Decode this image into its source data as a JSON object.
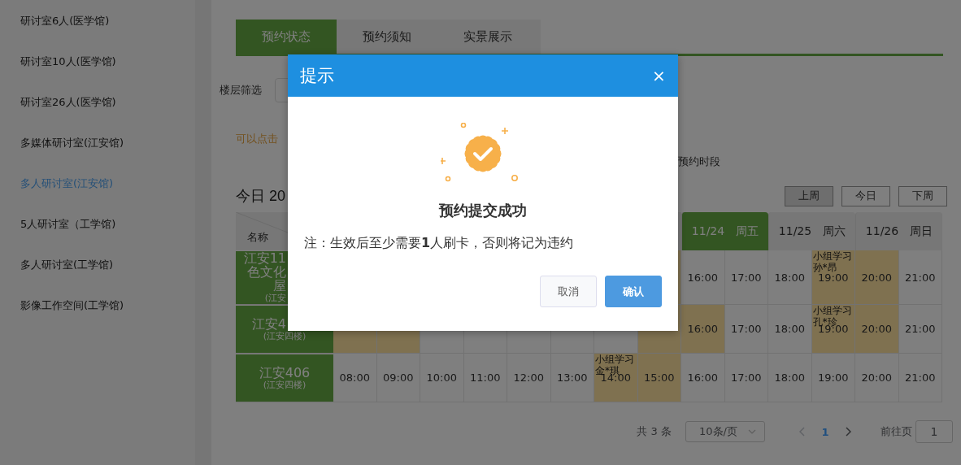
{
  "sidebar": {
    "items": [
      {
        "label": "研讨室6人(医学馆)",
        "selected": false
      },
      {
        "label": "研讨室10人(医学馆)",
        "selected": false
      },
      {
        "label": "研讨室26人(医学馆)",
        "selected": false
      },
      {
        "label": "多媒体研讨室(江安馆)",
        "selected": false
      },
      {
        "label": "多人研讨室(江安馆)",
        "selected": true
      },
      {
        "label": "5人研讨室（工学馆)",
        "selected": false
      },
      {
        "label": "多人研讨室(工学馆)",
        "selected": false
      },
      {
        "label": "影像工作空间(工学馆)",
        "selected": false
      }
    ]
  },
  "tabs": [
    {
      "label": "预约状态",
      "selected": true
    },
    {
      "label": "预约须知",
      "selected": false
    },
    {
      "label": "实景展示",
      "selected": false
    }
  ],
  "filter": {
    "label": "楼层筛选"
  },
  "hint": "可以点击",
  "legend_tail": "预约时段",
  "today_title": "今日 20",
  "week_buttons": [
    {
      "label": "上周",
      "selected": true
    },
    {
      "label": "今日",
      "selected": false
    },
    {
      "label": "下周",
      "selected": false
    }
  ],
  "table": {
    "name_header": "名称",
    "days": [
      {
        "date": "11/24",
        "weekday": "周五",
        "selected": true
      },
      {
        "date": "11/25",
        "weekday": "周六",
        "selected": false
      },
      {
        "date": "11/26",
        "weekday": "周日",
        "selected": false
      }
    ],
    "rows": [
      {
        "names": [
          {
            "text": "江安11",
            "covered": true
          },
          {
            "text": "色文化",
            "covered": true
          },
          {
            "text": "屋",
            "covered": true
          },
          {
            "text": "(江安",
            "covered": true,
            "small": true
          }
        ],
        "cells": [
          "",
          "",
          "",
          "",
          "",
          "",
          "",
          {
            "booked": true
          },
          {
            "time": "16:00",
            "booked": false
          },
          {
            "time": "17:00",
            "booked": false
          },
          {
            "time": "18:00",
            "booked": false
          },
          {
            "time": "19:00",
            "booked": true,
            "note": [
              "小组学习",
              "孙*昂"
            ]
          },
          {
            "time": "20:00",
            "booked": true
          },
          {
            "time": "21:00",
            "booked": false
          }
        ]
      },
      {
        "names": [
          {
            "text": "江安4",
            "covered": true
          },
          {
            "text": "(江安四楼)",
            "covered": false,
            "small": true
          }
        ],
        "cells": [
          {
            "booked": true
          },
          {
            "booked": true
          },
          {
            "booked": false
          },
          {
            "booked": false
          },
          {
            "booked": false
          },
          {
            "booked": false
          },
          {
            "booked": false
          },
          {
            "booked": true
          },
          {
            "time": "16:00",
            "booked": true
          },
          {
            "time": "17:00",
            "booked": false
          },
          {
            "time": "18:00",
            "booked": false
          },
          {
            "time": "19:00",
            "booked": true,
            "note": [
              "小组学习",
              "孔*珍"
            ]
          },
          {
            "time": "20:00",
            "booked": true
          },
          {
            "time": "21:00",
            "booked": false
          }
        ]
      },
      {
        "names": [
          {
            "text": "江安406",
            "covered": false
          },
          {
            "text": "(江安四楼)",
            "covered": false,
            "small": true
          }
        ],
        "cells": [
          {
            "time": "08:00",
            "booked": false
          },
          {
            "time": "09:00",
            "booked": false
          },
          {
            "time": "10:00",
            "booked": false
          },
          {
            "time": "11:00",
            "booked": false
          },
          {
            "time": "12:00",
            "booked": false
          },
          {
            "time": "13:00",
            "booked": false
          },
          {
            "time": "14:00",
            "booked": true,
            "note": [
              "小组学习",
              "金*琪"
            ]
          },
          {
            "time": "15:00",
            "booked": true
          },
          {
            "time": "16:00",
            "booked": false
          },
          {
            "time": "17:00",
            "booked": false
          },
          {
            "time": "18:00",
            "booked": false
          },
          {
            "time": "19:00",
            "booked": false
          },
          {
            "time": "20:00",
            "booked": false
          },
          {
            "time": "21:00",
            "booked": false
          }
        ]
      }
    ]
  },
  "pagination": {
    "total": "共 3 条",
    "page_size": "10条/页",
    "pages": [
      {
        "label": "1",
        "selected": true
      }
    ],
    "goto_label": "前往页",
    "goto_value": "1"
  },
  "dialog": {
    "title": "提示",
    "close": "×",
    "heading": "预约提交成功",
    "message": "注：生效后至少需要**1**人刷卡，否则将记为违约",
    "buttons": [
      {
        "label": "取消",
        "kind": "secondary"
      },
      {
        "label": "确认",
        "kind": "primary"
      }
    ]
  }
}
